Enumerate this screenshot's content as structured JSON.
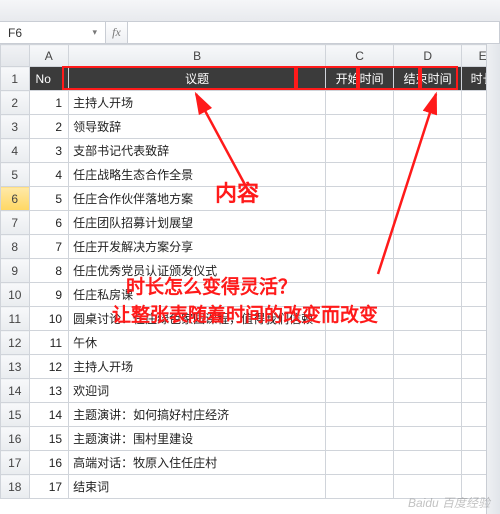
{
  "namebox": {
    "ref": "F6",
    "fx": "fx"
  },
  "colHeaders": [
    "A",
    "B",
    "C",
    "D",
    "E"
  ],
  "hdr": {
    "no": "No",
    "topic": "议题",
    "start": "开始时间",
    "end": "结束时间",
    "dur": "时长"
  },
  "rows": [
    {
      "n": "1",
      "t": "主持人开场"
    },
    {
      "n": "2",
      "t": "领导致辞"
    },
    {
      "n": "3",
      "t": "支部书记代表致辞"
    },
    {
      "n": "4",
      "t": "任庄战略生态合作全景"
    },
    {
      "n": "5",
      "t": "任庄合作伙伴落地方案"
    },
    {
      "n": "6",
      "t": "任庄团队招募计划展望"
    },
    {
      "n": "7",
      "t": "任庄开发解决方案分享"
    },
    {
      "n": "8",
      "t": "任庄优秀党员认证颁发仪式"
    },
    {
      "n": "9",
      "t": "任庄私房课"
    },
    {
      "n": "10",
      "t": "圆桌讨论：任庄绿色家园课程，值得我们信赖"
    },
    {
      "n": "11",
      "t": "午休"
    },
    {
      "n": "12",
      "t": "主持人开场"
    },
    {
      "n": "13",
      "t": "欢迎词"
    },
    {
      "n": "14",
      "t": "主题演讲：如何搞好村庄经济"
    },
    {
      "n": "15",
      "t": "主题演讲：围村里建设"
    },
    {
      "n": "16",
      "t": "高端对话：牧原入住任庄村"
    },
    {
      "n": "17",
      "t": "结束词"
    }
  ],
  "anno": {
    "content": "内容",
    "q": "时长怎么变得灵活？",
    "a": "让整张表随着时间的改变而改变"
  },
  "watermark": "Baidu 百度经验"
}
